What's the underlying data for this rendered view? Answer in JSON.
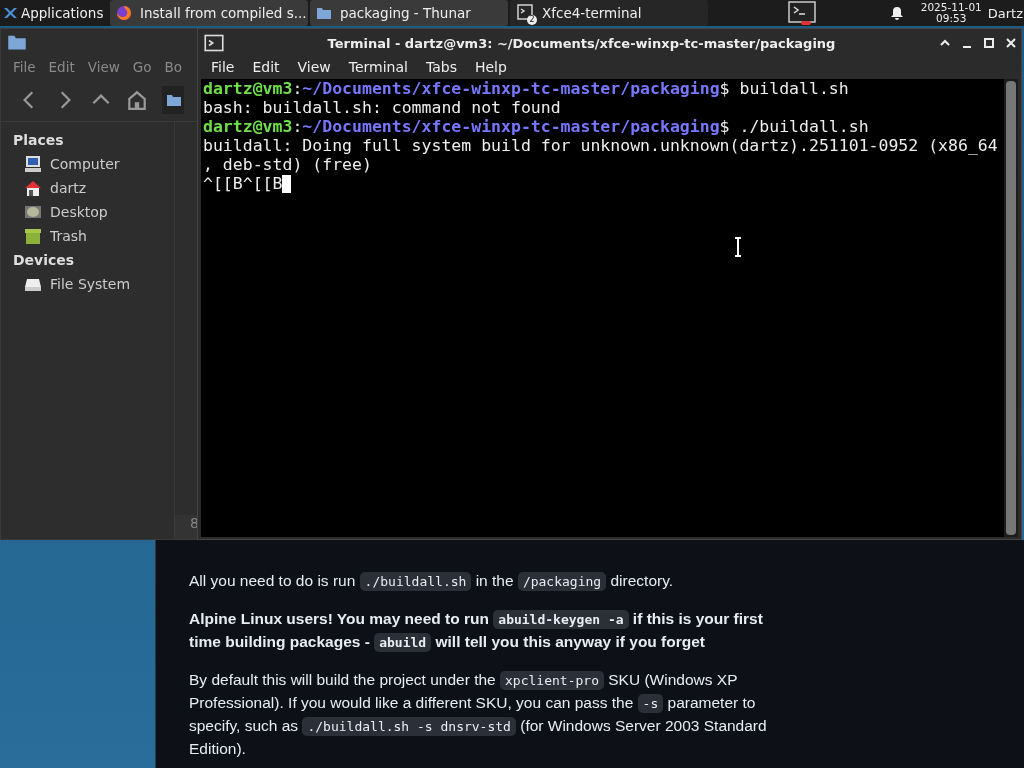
{
  "panel": {
    "apps_menu": "Applications",
    "tasks": [
      {
        "label": "Install from compiled s...",
        "selected": false
      },
      {
        "label": "packaging - Thunar",
        "selected": false
      },
      {
        "label": "Xfce4-terminal",
        "badge": "2",
        "selected": true
      }
    ],
    "clock": {
      "date": "2025-11-01",
      "time": "09:53"
    },
    "user": "Dartz"
  },
  "file_manager": {
    "menu": [
      "File",
      "Edit",
      "View",
      "Go",
      "Bo"
    ],
    "sidebar": [
      {
        "heading": "Places",
        "items": [
          {
            "label": "Computer"
          },
          {
            "label": "dartz"
          },
          {
            "label": "Desktop"
          },
          {
            "label": "Trash"
          }
        ]
      },
      {
        "heading": "Devices",
        "items": [
          {
            "label": "File System"
          }
        ]
      }
    ],
    "status": "8"
  },
  "terminal": {
    "title": "Terminal - dartz@vm3: ~/Documents/xfce-winxp-tc-master/packaging",
    "menu": [
      "File",
      "Edit",
      "View",
      "Terminal",
      "Tabs",
      "Help"
    ],
    "lines": [
      {
        "kind": "prompt",
        "user": "dartz@vm3",
        "sep": ":",
        "path": "~/Documents/xfce-winxp-tc-master/packaging",
        "mark": "$",
        "command": " buildall.sh"
      },
      {
        "kind": "output",
        "text": "bash: buildall.sh: command not found"
      },
      {
        "kind": "prompt",
        "user": "dartz@vm3",
        "sep": ":",
        "path": "~/Documents/xfce-winxp-tc-master/packaging",
        "mark": "$",
        "command": " ./buildall.sh"
      },
      {
        "kind": "output",
        "text": "buildall: Doing full system build for unknown.unknown(dartz).251101-0952 (x86_64"
      },
      {
        "kind": "output",
        "text": ", deb-std) (free)"
      },
      {
        "kind": "input",
        "text": "^[[B^[[B",
        "cursor": true
      }
    ]
  },
  "web_page": {
    "paragraphs": [
      {
        "bold": false,
        "parts": [
          {
            "text": "All you need to do is run ",
            "code": false
          },
          {
            "text": "./buildall.sh",
            "code": true
          },
          {
            "text": " in the ",
            "code": false
          },
          {
            "text": "/packaging",
            "code": true
          },
          {
            "text": " directory.",
            "code": false
          }
        ]
      },
      {
        "bold": true,
        "parts": [
          {
            "text": "Alpine Linux users! You may need to run ",
            "code": false
          },
          {
            "text": "abuild-keygen -a",
            "code": true
          },
          {
            "text": " if this is your first time building packages - ",
            "code": false
          },
          {
            "text": "abuild",
            "code": true
          },
          {
            "text": " will tell you this anyway if you forget",
            "code": false
          }
        ]
      },
      {
        "bold": false,
        "parts": [
          {
            "text": "By default this will build the project under the ",
            "code": false
          },
          {
            "text": "xpclient-pro",
            "code": true
          },
          {
            "text": " SKU (Windows XP Professional). If you would like a different SKU, you can pass the ",
            "code": false
          },
          {
            "text": "-s",
            "code": true
          },
          {
            "text": " parameter to specify, such as ",
            "code": false
          },
          {
            "text": "./buildall.sh -s dnsrv-std",
            "code": true
          },
          {
            "text": " (for Windows Server 2003 Standard Edition).",
            "code": false
          }
        ]
      }
    ]
  }
}
